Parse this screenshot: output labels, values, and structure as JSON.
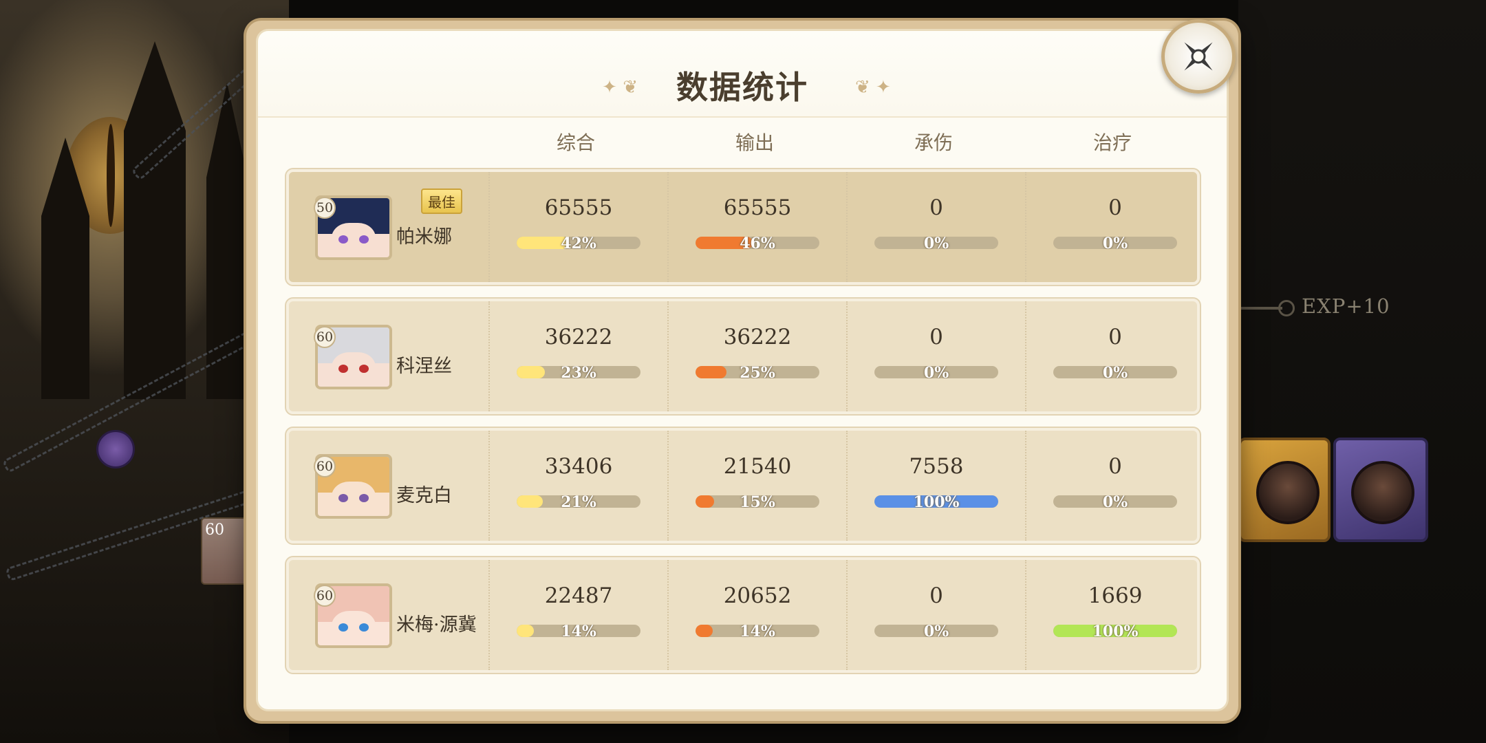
{
  "dialog": {
    "title": "数据统计",
    "close_icon": "close-icon",
    "columns": [
      "综合",
      "输出",
      "承伤",
      "治疗"
    ]
  },
  "background": {
    "exp_text": "EXP+10"
  },
  "colors": {
    "overall": "#ffe57a",
    "damage": "#f07a30",
    "tank": "#5a90e6",
    "heal": "#b2e655",
    "bar_track": "#c1b394"
  },
  "rows": [
    {
      "name": "帕米娜",
      "level": "50",
      "badge": "最佳",
      "best": true,
      "stats": [
        {
          "value": "65555",
          "percent": "42%",
          "fraction": 0.42
        },
        {
          "value": "65555",
          "percent": "46%",
          "fraction": 0.46
        },
        {
          "value": "0",
          "percent": "0%",
          "fraction": 0
        },
        {
          "value": "0",
          "percent": "0%",
          "fraction": 0
        }
      ]
    },
    {
      "name": "科涅丝",
      "level": "60",
      "badge": "",
      "best": false,
      "stats": [
        {
          "value": "36222",
          "percent": "23%",
          "fraction": 0.23
        },
        {
          "value": "36222",
          "percent": "25%",
          "fraction": 0.25
        },
        {
          "value": "0",
          "percent": "0%",
          "fraction": 0
        },
        {
          "value": "0",
          "percent": "0%",
          "fraction": 0
        }
      ]
    },
    {
      "name": "麦克白",
      "level": "60",
      "badge": "",
      "best": false,
      "stats": [
        {
          "value": "33406",
          "percent": "21%",
          "fraction": 0.21
        },
        {
          "value": "21540",
          "percent": "15%",
          "fraction": 0.15
        },
        {
          "value": "7558",
          "percent": "100%",
          "fraction": 1.0
        },
        {
          "value": "0",
          "percent": "0%",
          "fraction": 0
        }
      ]
    },
    {
      "name": "米梅·源冀",
      "level": "60",
      "badge": "",
      "best": false,
      "stats": [
        {
          "value": "22487",
          "percent": "14%",
          "fraction": 0.14
        },
        {
          "value": "20652",
          "percent": "14%",
          "fraction": 0.14
        },
        {
          "value": "0",
          "percent": "0%",
          "fraction": 0
        },
        {
          "value": "1669",
          "percent": "100%",
          "fraction": 1.0
        }
      ]
    }
  ]
}
